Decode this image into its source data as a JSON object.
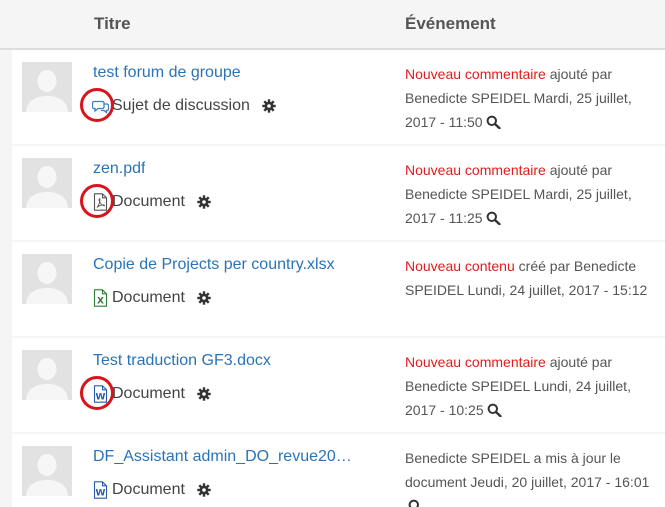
{
  "table": {
    "header": {
      "title_col": "Titre",
      "event_col": "Événement"
    },
    "rows": [
      {
        "title": "test forum de groupe",
        "type_label": "Sujet de discussion",
        "type_icon": "discussion-icon",
        "event_keyword": "Nouveau commentaire",
        "event_rest": " ajouté par Benedicte SPEIDEL Mardi, 25 juillet, 2017 - 11:50",
        "show_magnifier": true,
        "highlighted": true
      },
      {
        "title": "zen.pdf",
        "type_label": "Document",
        "type_icon": "pdf-file-icon",
        "event_keyword": "Nouveau commentaire",
        "event_rest": " ajouté par Benedicte SPEIDEL Mardi, 25 juillet, 2017 - 11:25",
        "show_magnifier": true,
        "highlighted": true
      },
      {
        "title": "Copie de Projects per country.xlsx",
        "type_label": "Document",
        "type_icon": "excel-file-icon",
        "event_keyword": "Nouveau contenu",
        "event_rest": " créé par Benedicte SPEIDEL Lundi, 24 juillet, 2017 - 15:12",
        "show_magnifier": false,
        "highlighted": false
      },
      {
        "title": "Test traduction GF3.docx",
        "type_label": "Document",
        "type_icon": "word-file-icon",
        "event_keyword": "Nouveau commentaire",
        "event_rest": " ajouté par Benedicte SPEIDEL Lundi, 24 juillet, 2017 - 10:25",
        "show_magnifier": true,
        "highlighted": true
      },
      {
        "title": "DF_Assistant admin_DO_revue20…",
        "type_label": "Document",
        "type_icon": "word-file-icon",
        "event_keyword": "",
        "event_rest": "Benedicte SPEIDEL a mis à jour le document Jeudi, 20 juillet, 2017 - 16:01",
        "show_magnifier": true,
        "highlighted": false
      }
    ]
  },
  "colors": {
    "link": "#2a73b8",
    "event_keyword": "#e01c1c",
    "highlight_circle": "#d8141b"
  }
}
